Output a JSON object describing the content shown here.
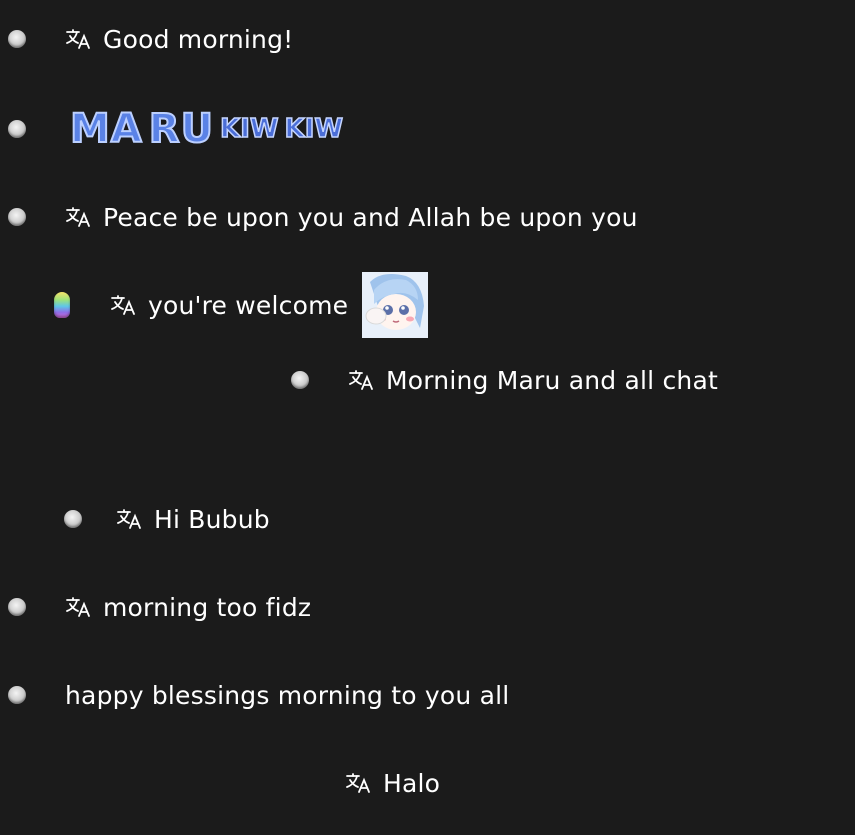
{
  "messages": [
    {
      "text": "Good morning!"
    },
    {
      "emote_parts": [
        "MA",
        "RU",
        "KIW",
        "KIW"
      ]
    },
    {
      "text": "Peace be upon you and Allah be upon you"
    },
    {
      "text": "you're welcome"
    },
    {
      "text": "Morning Maru and all chat"
    },
    {
      "text": "Hi Bubub"
    },
    {
      "text": "morning too fidz"
    },
    {
      "text": "happy blessings morning to you all"
    },
    {
      "text": "Halo"
    }
  ],
  "icons": {
    "translate": "translate-icon",
    "user_badge": "user-badge",
    "rainbow_badge": "rainbow-badge",
    "sticker": "anime-sticker"
  },
  "colors": {
    "background": "#1b1b1b",
    "text": "#ffffff",
    "emote_blue": "#5a82e6"
  }
}
